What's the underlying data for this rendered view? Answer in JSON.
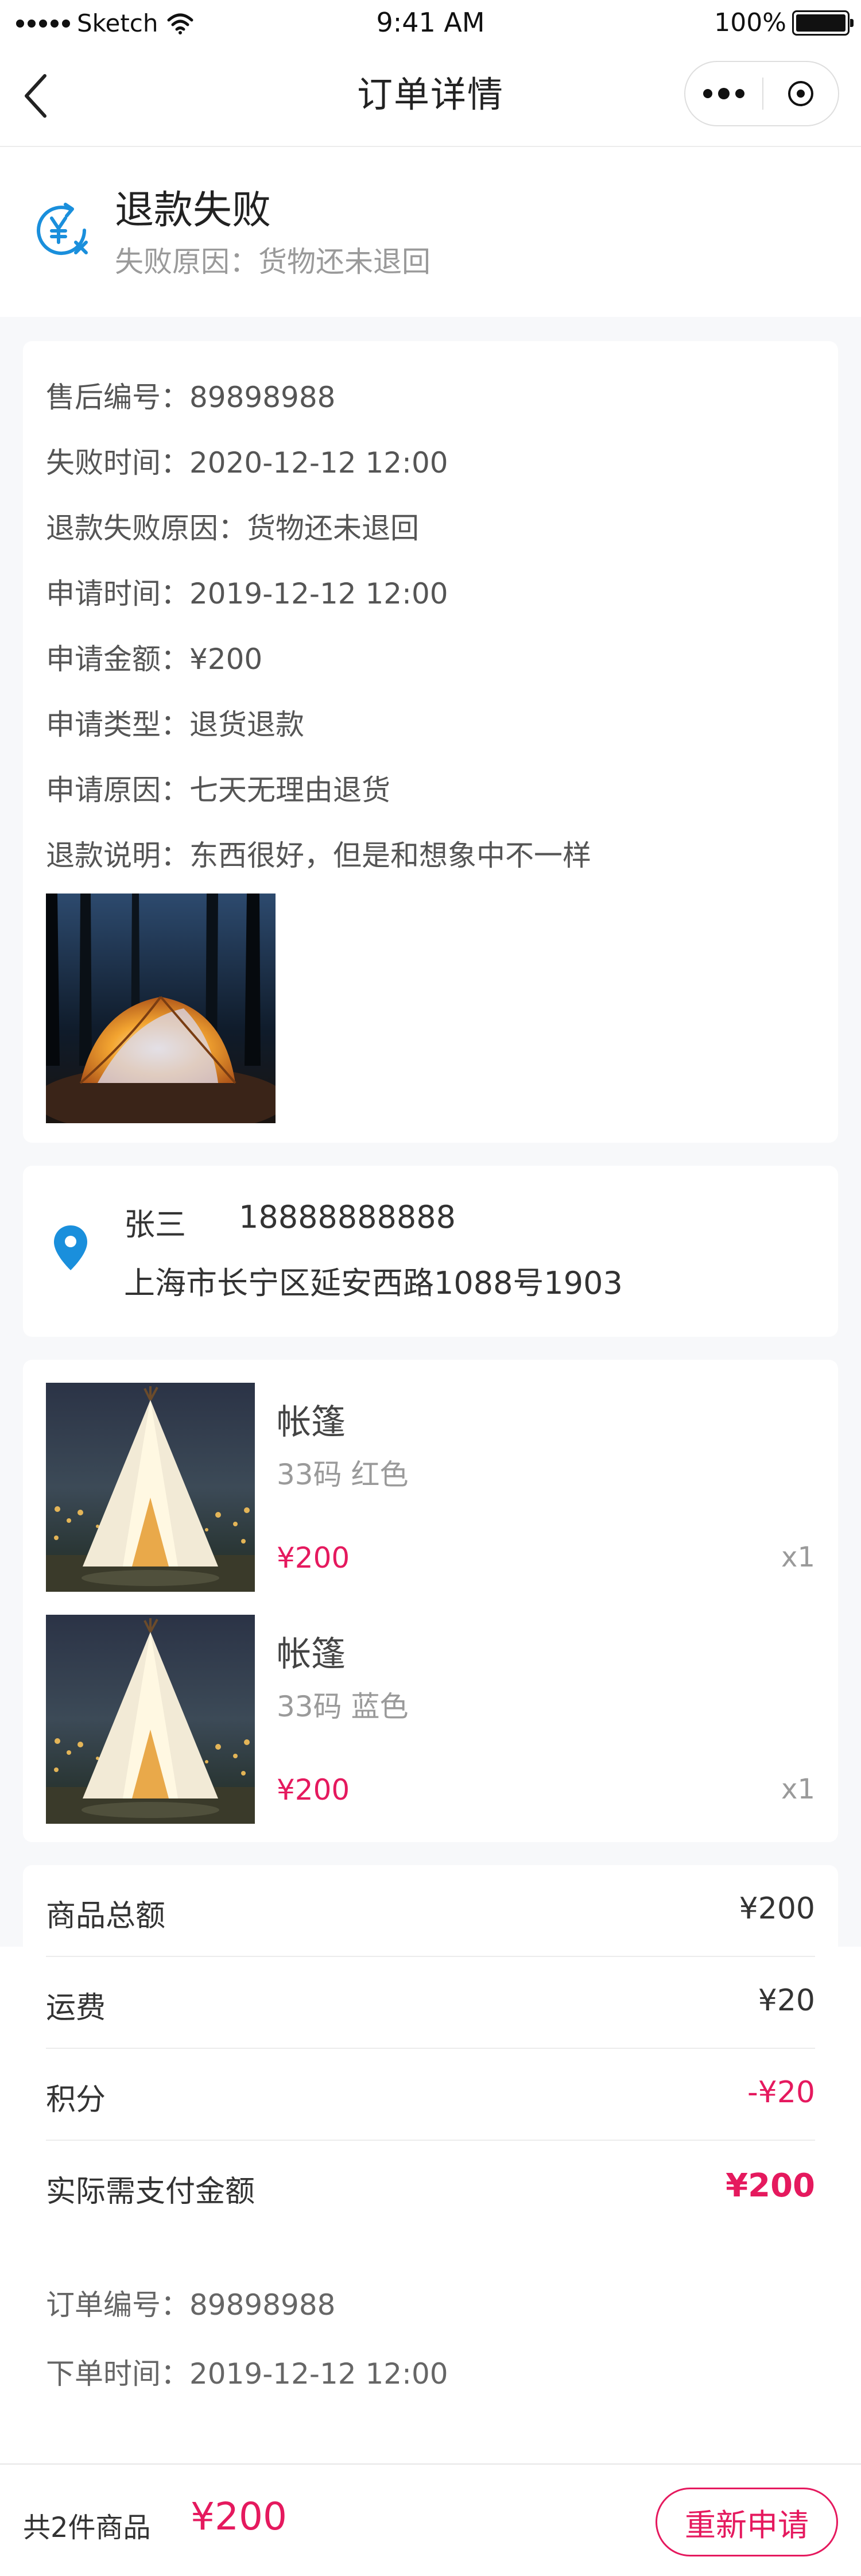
{
  "status_bar": {
    "carrier": "Sketch",
    "time": "9:41 AM",
    "battery": "100%",
    "battery_level": 1.0
  },
  "nav": {
    "title": "订单详情",
    "back_icon": "chevron-left-icon",
    "more_icon": "more-dots-icon",
    "close_icon": "target-circle-icon"
  },
  "refund_status": {
    "icon": "refund-yuan-icon",
    "title": "退款失败",
    "reason": "失败原因：货物还未退回"
  },
  "refund_info": {
    "lines": [
      "售后编号：89898988",
      "失败时间：2020-12-12 12:00",
      "退款失败原因：货物还未退回",
      "申请时间：2019-12-12 12:00",
      "申请金额：¥200",
      "申请类型：退货退款",
      "申请原因：七天无理由退货",
      "退款说明：东西很好，但是和想象中不一样"
    ]
  },
  "address": {
    "icon": "location-pin-icon",
    "name": "张三",
    "phone": "18888888888",
    "address": "上海市长宁区延安西路1088号1903"
  },
  "products": [
    {
      "name": "帐篷",
      "spec": "33码 红色",
      "price": "¥200",
      "qty": "x1"
    },
    {
      "name": "帐篷",
      "spec": "33码 蓝色",
      "price": "¥200",
      "qty": "x1"
    }
  ],
  "summary": {
    "rows": [
      {
        "label": "商品总额",
        "value": "¥200"
      },
      {
        "label": "运费",
        "value": "¥20"
      },
      {
        "label": "积分",
        "value": "-¥20"
      },
      {
        "label": "实际需支付金额",
        "value": "¥200"
      }
    ],
    "order_no": "订单编号：89898988",
    "order_time": "下单时间：2019-12-12 12:00"
  },
  "bottom_bar": {
    "count": "共2件商品",
    "total": "¥200",
    "reapply": "重新申请"
  },
  "colors": {
    "accent": "#e5195e",
    "icon_blue": "#1a8fdc",
    "background": "#f7f8fa"
  }
}
